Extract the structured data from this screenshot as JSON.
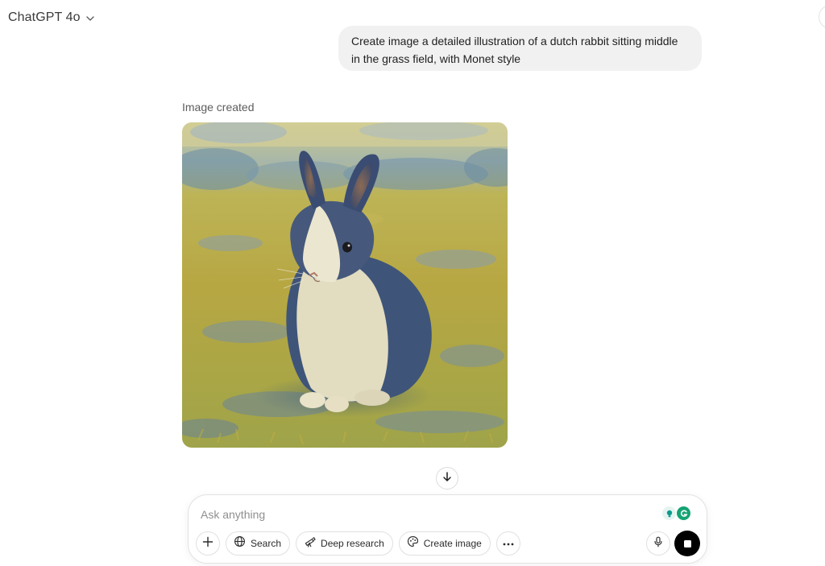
{
  "header": {
    "model_name": "ChatGPT 4o",
    "chevron_icon": "chevron-down-icon"
  },
  "conversation": {
    "user_message": "Create image a detailed illustration of a dutch rabbit sitting middle in the grass field, with Monet style",
    "assistant": {
      "status_label": "Image created",
      "image_description_icon": "generated-image"
    }
  },
  "composer": {
    "placeholder": "Ask anything",
    "buttons": {
      "add_icon": "plus-icon",
      "search_label": "Search",
      "deep_research_label": "Deep research",
      "create_image_label": "Create image",
      "more_icon": "ellipsis-icon",
      "mic_icon": "microphone-icon",
      "stop_icon": "stop-icon"
    },
    "extensions": [
      "lightbulb-icon",
      "grammarly-icon"
    ]
  },
  "colors": {
    "bubble_bg": "#f1f1f1",
    "stop_button": "#000000",
    "grammarly_green": "#15a374",
    "ext_teal": "#0f9b8e"
  }
}
